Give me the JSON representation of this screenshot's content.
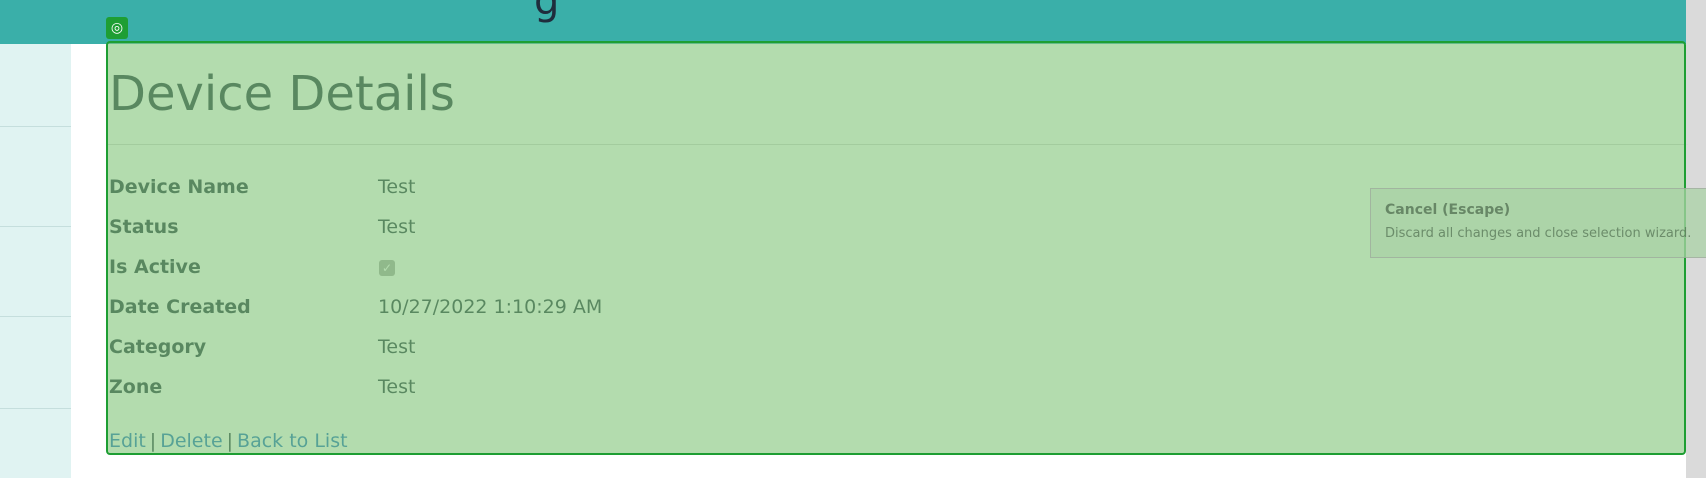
{
  "header": {
    "title_glyph": "g",
    "color": "#3aafa9"
  },
  "sidebar": {
    "color": "#e0f3f2"
  },
  "page": {
    "title": "Device Details"
  },
  "details": [
    {
      "label": "Device Name",
      "value": "Test"
    },
    {
      "label": "Status",
      "value": "Test"
    },
    {
      "label": "Is Active",
      "value": true
    },
    {
      "label": "Date Created",
      "value": "10/27/2022 1:10:29 AM"
    },
    {
      "label": "Category",
      "value": "Test"
    },
    {
      "label": "Zone",
      "value": "Test"
    }
  ],
  "links": {
    "edit": "Edit",
    "separator": "|",
    "delete": "Delete",
    "back": "Back to List"
  },
  "selection_overlay": {
    "handle_icon": "target-icon",
    "color": "#1e9e33"
  },
  "tooltip": {
    "title": "Cancel (Escape)",
    "description": "Discard all changes and close selection wizard."
  }
}
